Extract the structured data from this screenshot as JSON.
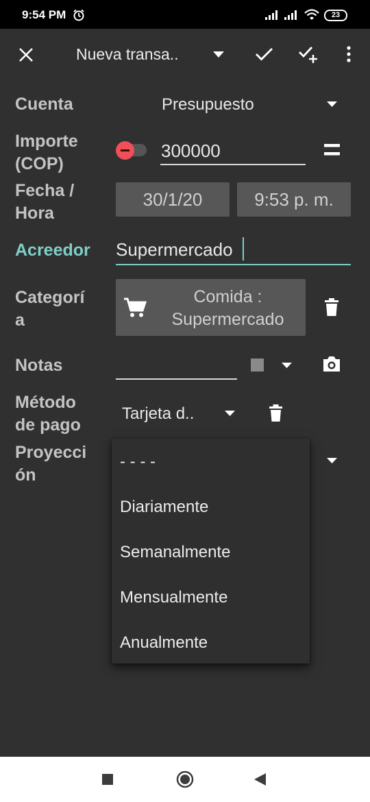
{
  "status_bar": {
    "time": "9:54 PM",
    "battery": "23",
    "icons": [
      "alarm-icon",
      "signal-icon",
      "signal-icon",
      "wifi-icon",
      "battery-icon"
    ]
  },
  "toolbar": {
    "title": "Nueva transa..",
    "icons": [
      "close-icon",
      "dropdown-arrow-icon",
      "check-icon",
      "check-add-icon",
      "more-vert-icon"
    ]
  },
  "form": {
    "cuenta": {
      "label": "Cuenta",
      "value": "Presupuesto"
    },
    "importe": {
      "label_line1": "Importe",
      "label_line2": "(COP)",
      "value": "300000"
    },
    "fecha": {
      "label_line1": "Fecha /",
      "label_line2": "Hora",
      "date": "30/1/20",
      "time": "9:53 p. m."
    },
    "acreedor": {
      "label": "Acreedor",
      "value": "Supermercado"
    },
    "categoria": {
      "label_line1": "Categorí",
      "label_line2": "a",
      "value_line1": "Comida :",
      "value_line2": "Supermercado"
    },
    "notas": {
      "label": "Notas",
      "value": ""
    },
    "metodo_pago": {
      "label_line1": "Método",
      "label_line2": "de pago",
      "value": "Tarjeta d.."
    },
    "proyeccion": {
      "label_line1": "Proyecci",
      "label_line2": "ón",
      "selected": "- - - -"
    }
  },
  "dropdown": {
    "options": [
      "Diariamente",
      "Semanalmente",
      "Mensualmente",
      "Anualmente"
    ]
  },
  "colors": {
    "accent": "#7fcfc7",
    "background": "#303030",
    "negative": "#ef4f57",
    "button": "#575757"
  }
}
